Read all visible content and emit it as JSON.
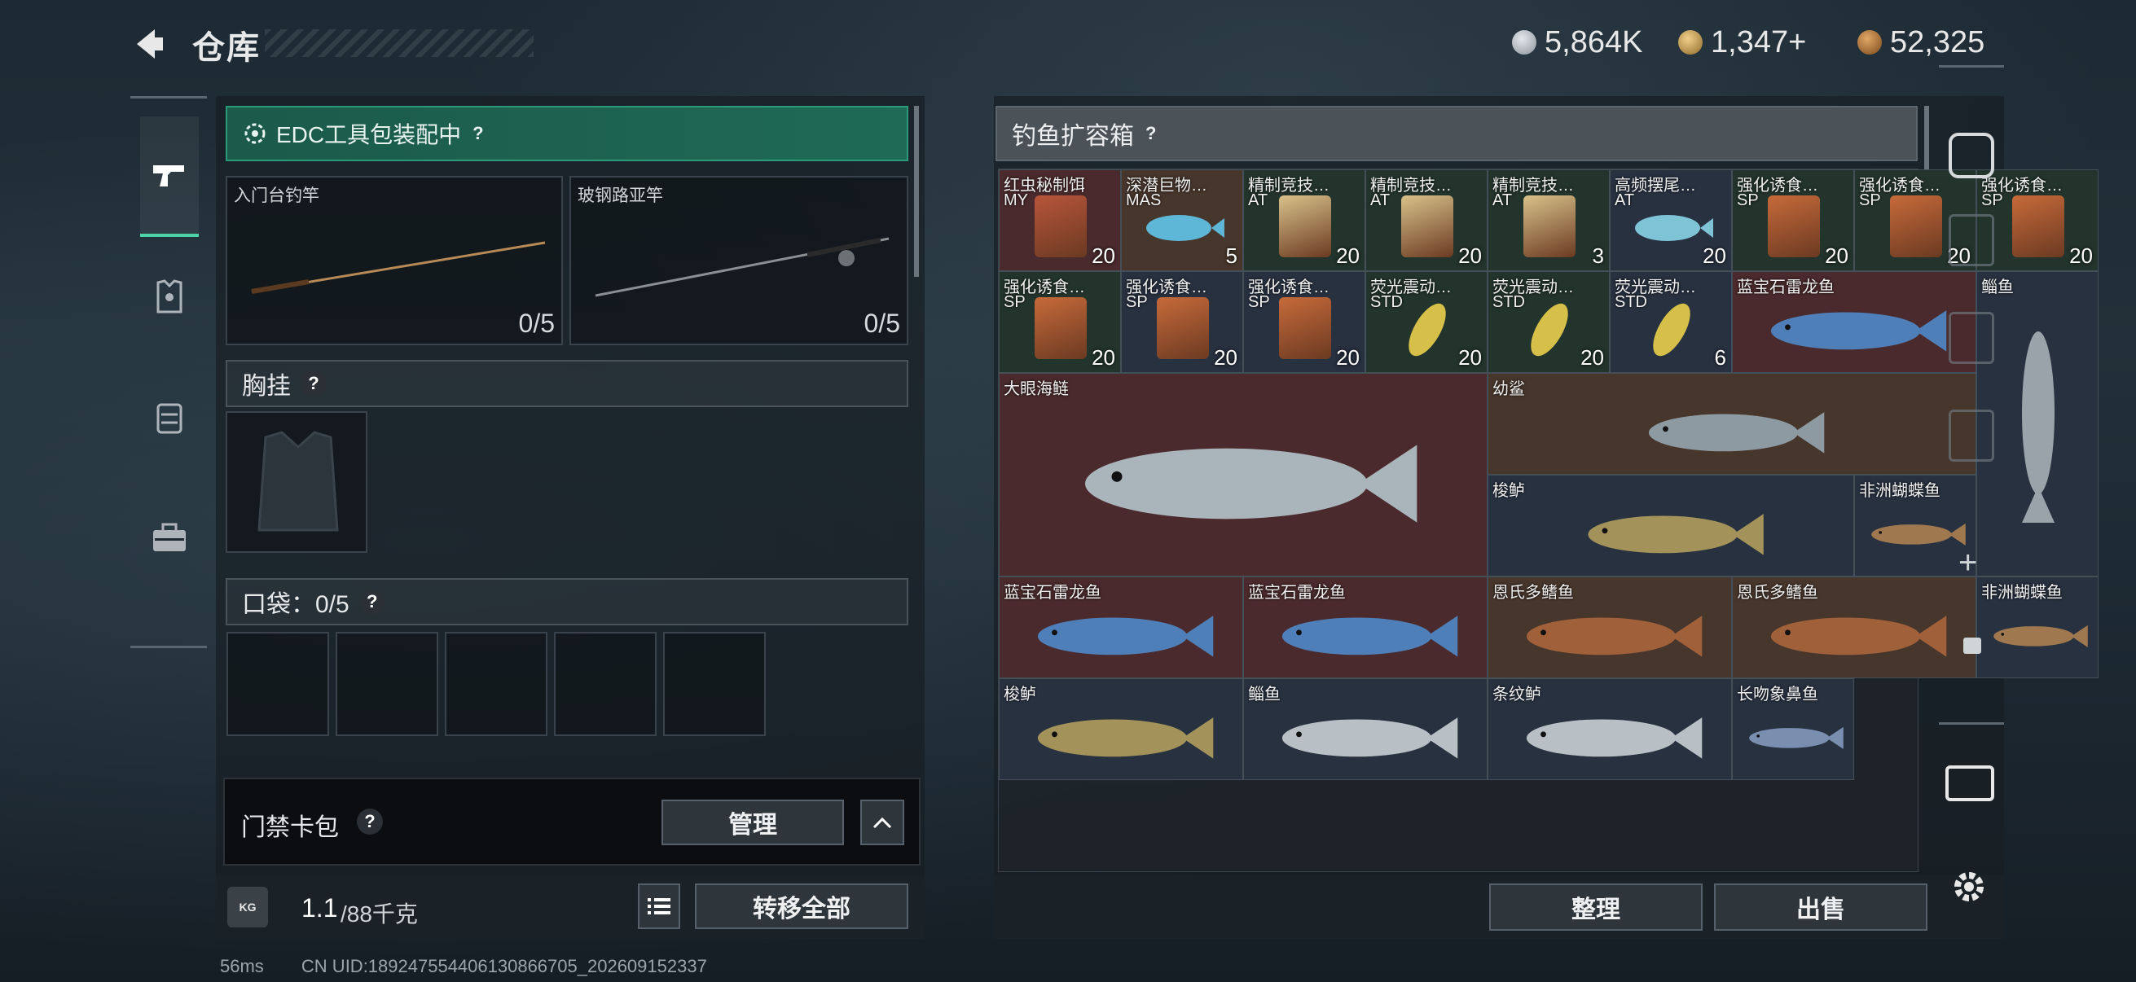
{
  "header": {
    "title": "仓库"
  },
  "currencies": [
    {
      "icon": "silver-coin-icon",
      "value": "5,864K",
      "color": "#b8c0c8"
    },
    {
      "icon": "gold-triangle-coin-icon",
      "value": "1,347+",
      "color": "#c9a257"
    },
    {
      "icon": "bronze-coin-icon",
      "value": "52,325",
      "color": "#b97a3a"
    }
  ],
  "left": {
    "edc_label": "EDC工具包装配中",
    "help": "?",
    "rod_slots": [
      {
        "label": "入门台钓竿",
        "count": "0/5"
      },
      {
        "label": "玻钢路亚竿",
        "count": "0/5"
      }
    ],
    "chest": "胸挂",
    "pocket": "口袋：0/5",
    "card_pack": "门禁卡包",
    "manage": "管理",
    "weight_value": "1.1",
    "weight_total": "/88千克",
    "transfer_all": "转移全部",
    "kg": "KG"
  },
  "box": {
    "title": "钓鱼扩容箱",
    "sort": "整理",
    "sell": "出售",
    "items": [
      {
        "name": "红虫秘制饵",
        "sub": "MY",
        "count": "20"
      },
      {
        "name": "深潜巨物…",
        "sub": "MAS",
        "count": "5"
      },
      {
        "name": "精制竞技…",
        "sub": "AT",
        "count": "20"
      },
      {
        "name": "精制竞技…",
        "sub": "AT",
        "count": "20"
      },
      {
        "name": "精制竞技…",
        "sub": "AT",
        "count": "3"
      },
      {
        "name": "高频摆尾…",
        "sub": "AT",
        "count": "20"
      },
      {
        "name": "强化诱食…",
        "sub": "SP",
        "count": "20"
      },
      {
        "name": "强化诱食…",
        "sub": "SP",
        "count": "20"
      },
      {
        "name": "强化诱食…",
        "sub": "SP",
        "count": "20"
      },
      {
        "name": "强化诱食…",
        "sub": "SP",
        "count": "20"
      },
      {
        "name": "强化诱食…",
        "sub": "SP",
        "count": "20"
      },
      {
        "name": "强化诱食…",
        "sub": "SP",
        "count": "20"
      },
      {
        "name": "荧光震动…",
        "sub": "STD",
        "count": "20"
      },
      {
        "name": "荧光震动…",
        "sub": "STD",
        "count": "20"
      },
      {
        "name": "荧光震动…",
        "sub": "STD",
        "count": "6"
      },
      {
        "name": "蓝宝石雷龙鱼"
      },
      {
        "name": "鲻鱼"
      },
      {
        "name": "大眼海鲢"
      },
      {
        "name": "幼鲨"
      },
      {
        "name": "梭鲈"
      },
      {
        "name": "非洲蝴蝶鱼"
      },
      {
        "name": "蓝宝石雷龙鱼"
      },
      {
        "name": "蓝宝石雷龙鱼"
      },
      {
        "name": "恩氏多鳍鱼"
      },
      {
        "name": "恩氏多鳍鱼"
      },
      {
        "name": "非洲蝴蝶鱼"
      },
      {
        "name": "梭鲈"
      },
      {
        "name": "鲻鱼"
      },
      {
        "name": "条纹鲈"
      },
      {
        "name": "长吻象鼻鱼"
      }
    ]
  },
  "footer": {
    "ping": "56ms",
    "uid": "CN UID:18924755440613086670​5_202609152337"
  }
}
